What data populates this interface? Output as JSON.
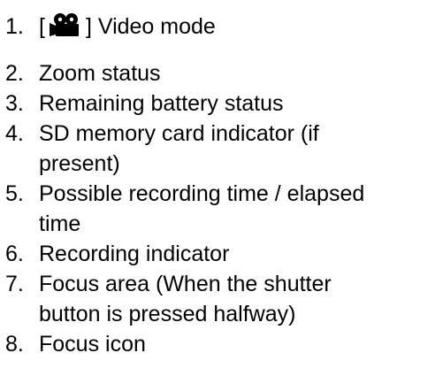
{
  "items": [
    {
      "number": "1.",
      "prefix": "[",
      "icon": "video-camera-icon",
      "suffix": "] Video mode"
    },
    {
      "number": "2.",
      "text": "Zoom status"
    },
    {
      "number": "3.",
      "text": "Remaining battery status"
    },
    {
      "number": "4.",
      "text": "SD memory card indicator (if",
      "continuation": "present)"
    },
    {
      "number": "5.",
      "text": "Possible recording time / elapsed",
      "continuation": "time"
    },
    {
      "number": "6.",
      "text": "Recording indicator"
    },
    {
      "number": "7.",
      "text": "Focus area (When the shutter",
      "continuation": "button is pressed halfway)"
    },
    {
      "number": "8.",
      "text": "Focus icon"
    }
  ]
}
